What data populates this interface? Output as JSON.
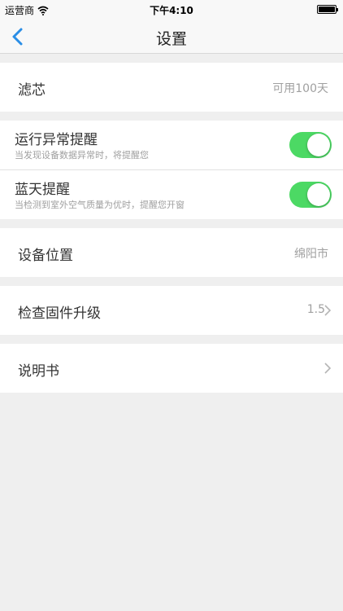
{
  "status_bar": {
    "carrier": "运营商",
    "time": "下午4:10"
  },
  "nav": {
    "title": "设置"
  },
  "filter": {
    "label": "滤芯",
    "value": "可用100天"
  },
  "alerts": [
    {
      "title": "运行异常提醒",
      "subtitle": "当发现设备数据异常时，将提醒您",
      "enabled": true
    },
    {
      "title": "蓝天提醒",
      "subtitle": "当检测到室外空气质量为优时，提醒您开窗",
      "enabled": true
    }
  ],
  "location": {
    "label": "设备位置",
    "value": "绵阳市"
  },
  "firmware": {
    "label": "检查固件升级",
    "value": "1.5"
  },
  "manual": {
    "label": "说明书"
  },
  "colors": {
    "accent": "#2a8ee6",
    "toggle_on": "#4cd964",
    "background": "#efefef"
  }
}
